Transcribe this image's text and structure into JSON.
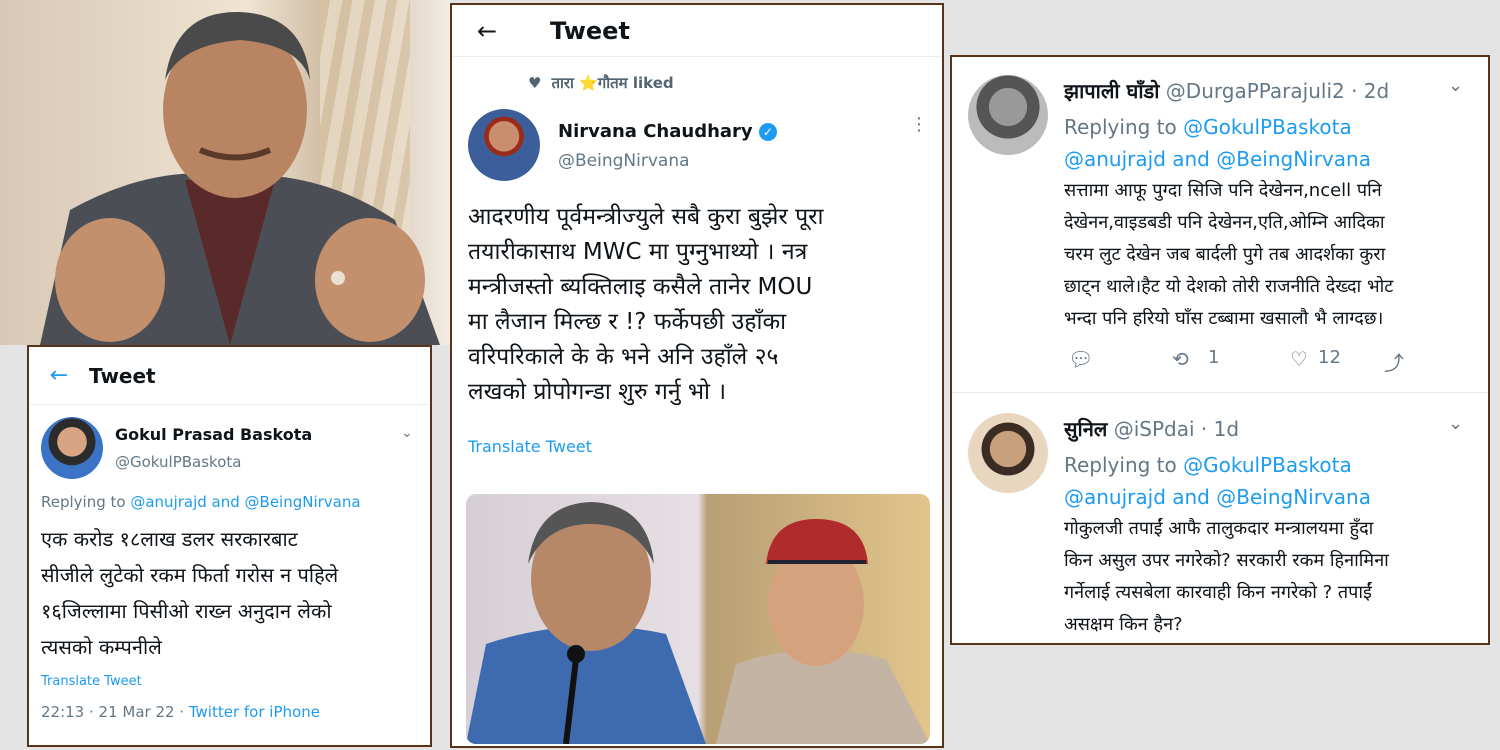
{
  "left_tweet": {
    "header_title": "Tweet",
    "author_name": "Gokul Prasad Baskota",
    "author_handle": "@GokulPBaskota",
    "replying_prefix": "Replying to",
    "replying_to": "@anujrajd and @BeingNirvana",
    "body_lines": [
      "एक करोड १८लाख डलर सरकारबाट",
      "सीजीले लुटेको रकम फिर्ता गरोस न पहिले",
      "१६जिल्लामा पिसीओ राख्न अनुदान लेको",
      "त्यसको कम्पनीले"
    ],
    "translate": "Translate Tweet",
    "time": "22:13 · 21 Mar 22 · ",
    "source": "Twitter for iPhone"
  },
  "mid_tweet": {
    "header_title": "Tweet",
    "liked_by": "तारा ⭐गौतम liked",
    "author_name": "Nirvana Chaudhary",
    "author_handle": "@BeingNirvana",
    "body_lines": [
      "आदरणीय पूर्वमन्त्रीज्युले सबै कुरा बुझेर पूरा",
      "तयारीकासाथ MWC मा पुग्नुभाथ्यो । नत्र",
      "मन्त्रीजस्तो ब्यक्तिलाइ कसैले तानेर MOU",
      "मा लैजान मिल्छ र !? फर्केपछी उहाँका",
      "वरिपरिकाले के के भने अनि उहाँले २५",
      "लखको प्रोपोगन्डा शुरु गर्नु भो ।"
    ],
    "translate": "Translate Tweet"
  },
  "right_replies": [
    {
      "name": "झापाली घाँडो",
      "handle": "@DurgaPParajuli2",
      "age": "· 2d",
      "replying_prefix": "Replying to",
      "replying_line1": "@GokulPBaskota",
      "replying_line2": "@anujrajd and @BeingNirvana",
      "body_lines": [
        "सत्तामा आफू पुग्दा सिजि पनि देखेनन,ncell पनि",
        "देखेनन,वाइडबडी पनि देखेनन,एति,ओम्नि आदिका",
        "चरम लुट देखेन जब बार्दली पुगे तब आदर्शका कुरा",
        "छाट्न थाले।हैट यो देशको तोरी राजनीति देख्दा भोट",
        "भन्दा पनि हरियो घाँस टब्बामा खसालौ भै लाग्दछ।"
      ],
      "retweets": "1",
      "likes": "12"
    },
    {
      "name": "सुनिल",
      "handle": "@iSPdai",
      "age": "· 1d",
      "replying_prefix": "Replying to",
      "replying_line1": "@GokulPBaskota",
      "replying_line2": "@anujrajd and @BeingNirvana",
      "body_lines": [
        "गोकुलजी तपाईं आफै तालुकदार मन्त्रालयमा हुँदा",
        "किन असुल उपर नगरेको? सरकारी रकम हिनामिना",
        "गर्नेलाई त्यसबेला कारवाही किन नगरेको ? तपाईं",
        "असक्षम किन हैन?"
      ]
    }
  ],
  "colors": {
    "link": "#1d9bf0",
    "border": "#5a3418",
    "grey": "#657786"
  }
}
